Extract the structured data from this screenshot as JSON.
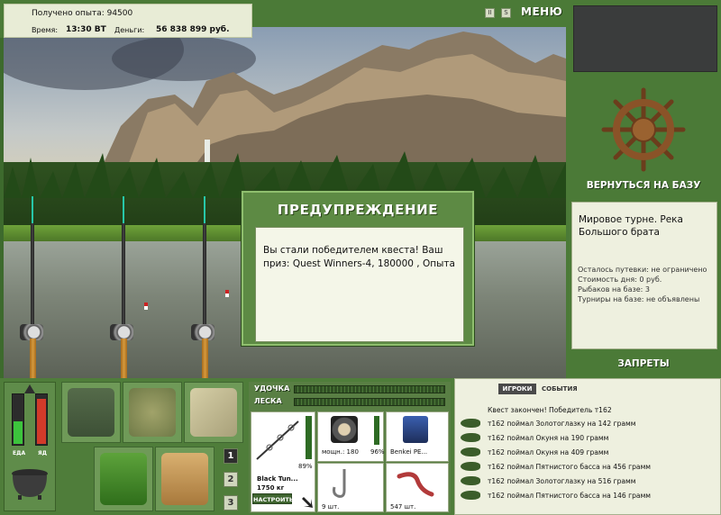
{
  "top": {
    "experience": "Получено опыта: 94500",
    "time_label": "Время:",
    "time_value": "13:30 ВТ",
    "money_label": "Деньги:",
    "money_value": "56 838 899 руб.",
    "pause_icon": "II",
    "sound_icon": "S",
    "menu_label": "МЕНЮ"
  },
  "warning": {
    "title": "ПРЕДУПРЕЖДЕНИЕ",
    "message": "Вы стали победителем квеста! Ваш приз: Quest Winners-4, 180000 , Опыта"
  },
  "sidebar": {
    "back_label": "ВЕРНУТЬСЯ НА БАЗУ",
    "location": "Мировое турне. Река Большого брата",
    "stats": [
      "Осталось путевки: не ограничено",
      "Стоимость дня: 0 руб.",
      "Рыбаков на базе: 3",
      "Турниры на базе: не объявлены"
    ],
    "bans_label": "ЗАПРЕТЫ"
  },
  "gauges": {
    "food_label": "ЕДА",
    "poison_label": "ЯД",
    "food_level": 0.45,
    "poison_level": 0.9,
    "food_color": "#3cc43c",
    "poison_color": "#d23a2a"
  },
  "inventory": {
    "pages": [
      "1",
      "2",
      "3"
    ],
    "active_page": "1"
  },
  "tackle": {
    "rod_label": "УДОЧКА",
    "line_label": "ЛЕСКА",
    "rod_name": "Black Tun...",
    "rod_capacity": "1750 кг",
    "rod_wear": "89%",
    "reel_power": "мощн.: 180",
    "reel_wear": "96%",
    "line_name": "Benkei PE...",
    "hook_count": "9 шт.",
    "bait_count": "547 шт.",
    "setup_label": "НАСТРОИТЬ"
  },
  "chat": {
    "tab_players": "ИГРОКИ",
    "tab_events": "СОБЫТИЯ",
    "header": "Квест закончен! Победитель т162",
    "lines": [
      "т162 поймал Золотоглазку на 142 грамм",
      "т162 поймал Окуня на 190 грамм",
      "т162 поймал Окуня на 409 грамм",
      "т162 поймал Пятнистого басса на 456 грамм",
      "т162 поймал Золотоглазку на 516 грамм",
      "т162 поймал Пятнистого басса на 146 грамм"
    ]
  }
}
